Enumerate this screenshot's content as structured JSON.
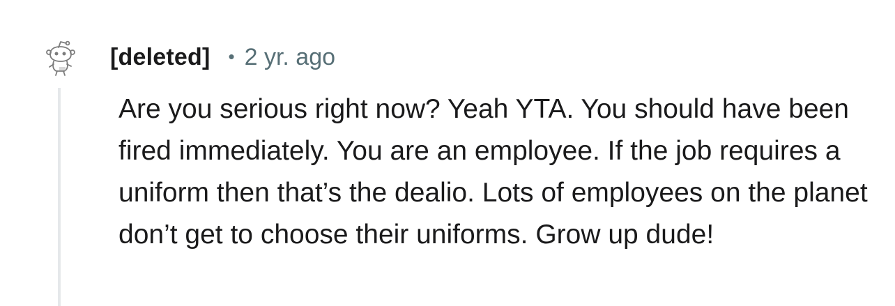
{
  "comment": {
    "author": "[deleted]",
    "separator": "•",
    "timestamp": "2 yr. ago",
    "body": "Are you serious right now? Yeah YTA. You should have been fired immediately. You are an employee. If the job requires a uniform then that’s the dealio. Lots of employees on the planet don’t get to choose their uniforms. Grow up dude!",
    "avatar_icon": "snoo-avatar-icon"
  },
  "colors": {
    "author": "#1a1a1b",
    "meta": "#576f76",
    "thread_line": "#e5e8ea",
    "avatar_stroke": "#7c7c7c"
  }
}
